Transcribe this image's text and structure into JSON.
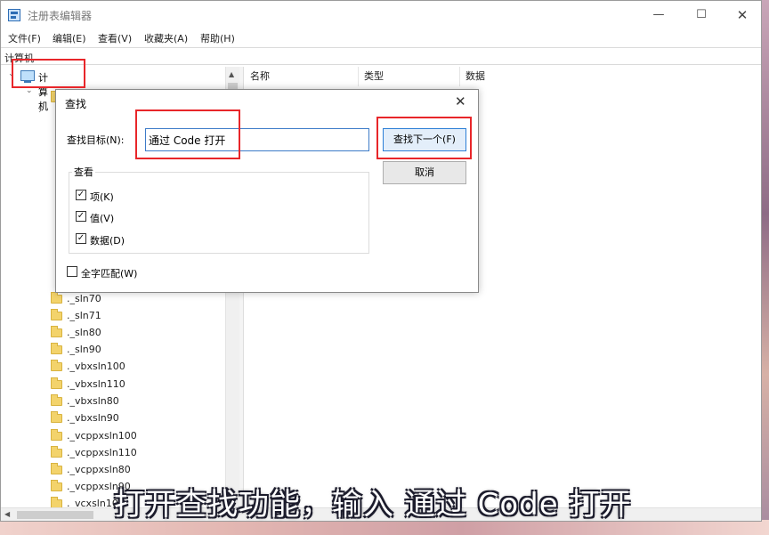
{
  "window": {
    "title": "注册表编辑器",
    "minimize": "—",
    "maximize": "☐",
    "close": "✕"
  },
  "menu": [
    "文件(F)",
    "编辑(E)",
    "查看(V)",
    "收藏夹(A)",
    "帮助(H)"
  ],
  "address": "计算机",
  "tree": {
    "root_label": "计算机",
    "items": [
      "._sln70",
      "._sln71",
      "._sln80",
      "._sln90",
      "._vbxsln100",
      "._vbxsln110",
      "._vbxsln80",
      "._vbxsln90",
      "._vcppxsln100",
      "._vcppxsln110",
      "._vcppxsln80",
      "._vcppxsln90",
      "._vcxsln10"
    ]
  },
  "columns": [
    "名称",
    "类型",
    "数据"
  ],
  "dialog": {
    "title": "查找",
    "find_label": "查找目标(N):",
    "find_value": "通过 Code 打开",
    "find_next": "查找下一个(F)",
    "cancel": "取消",
    "group_title": "查看",
    "options": [
      {
        "label": "项(K)",
        "checked": true
      },
      {
        "label": "值(V)",
        "checked": true
      },
      {
        "label": "数据(D)",
        "checked": true
      }
    ],
    "whole_match": {
      "label": "全字匹配(W)",
      "checked": false
    }
  },
  "subtitle": "打开查找功能，输入 通过 Code 打开",
  "icons": {
    "check": "✓",
    "expand_open": "⌄",
    "expand_closed": "›",
    "scroll_up": "▲",
    "scroll_left": "◀"
  }
}
